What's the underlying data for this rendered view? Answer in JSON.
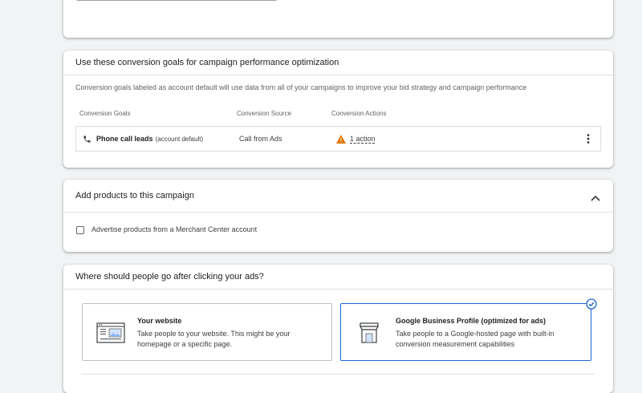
{
  "goals_card": {
    "title": "Use these conversion goals for campaign performance optimization",
    "description": "Conversion goals labeled as account default will use data from all of your campaigns to improve your bid strategy and campaign performance",
    "columns": [
      "Conversion Goals",
      "Conversion Source",
      "Conversion Actions"
    ],
    "row": {
      "goal_name": "Phone call leads",
      "goal_suffix": "(account default)",
      "source": "Call from Ads",
      "actions": "1 action"
    }
  },
  "products_card": {
    "title": "Add products to this campaign",
    "checkbox_label": "Advertise products from a Merchant Center account",
    "checkbox_checked": false
  },
  "destination_card": {
    "title": "Where should people go after clicking your ads?",
    "options": [
      {
        "title": "Your website",
        "description": "Take people to your website. This might be your homepage or a specific page.",
        "selected": false
      },
      {
        "title": "Google Business Profile (optimized for ads)",
        "description": "Take people to a Google-hosted page with built-in conversion measurement capabilities",
        "selected": true
      }
    ]
  },
  "colors": {
    "accent": "#1a73e8",
    "warning": "#e37400",
    "background": "#f1f3f4"
  }
}
